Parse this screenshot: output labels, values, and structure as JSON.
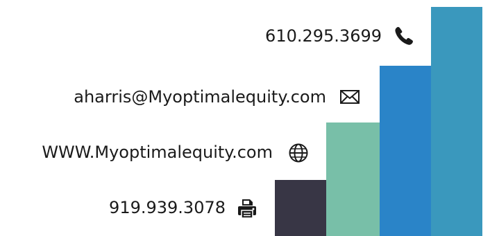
{
  "contacts": {
    "phone": {
      "text": "610.295.3699",
      "icon": "phone-icon"
    },
    "email": {
      "text": "aharris@Myoptimalequity.com",
      "icon": "envelope-icon"
    },
    "website": {
      "text": "WWW.Myoptimalequity.com",
      "icon": "globe-icon"
    },
    "fax": {
      "text": "919.939.3078",
      "icon": "printer-icon"
    }
  },
  "colors": {
    "bar_dark": "#383645",
    "bar_green": "#78bfa8",
    "bar_blue": "#2a84c8",
    "bar_teal": "#3a98bd",
    "text": "#1a1a1a"
  }
}
